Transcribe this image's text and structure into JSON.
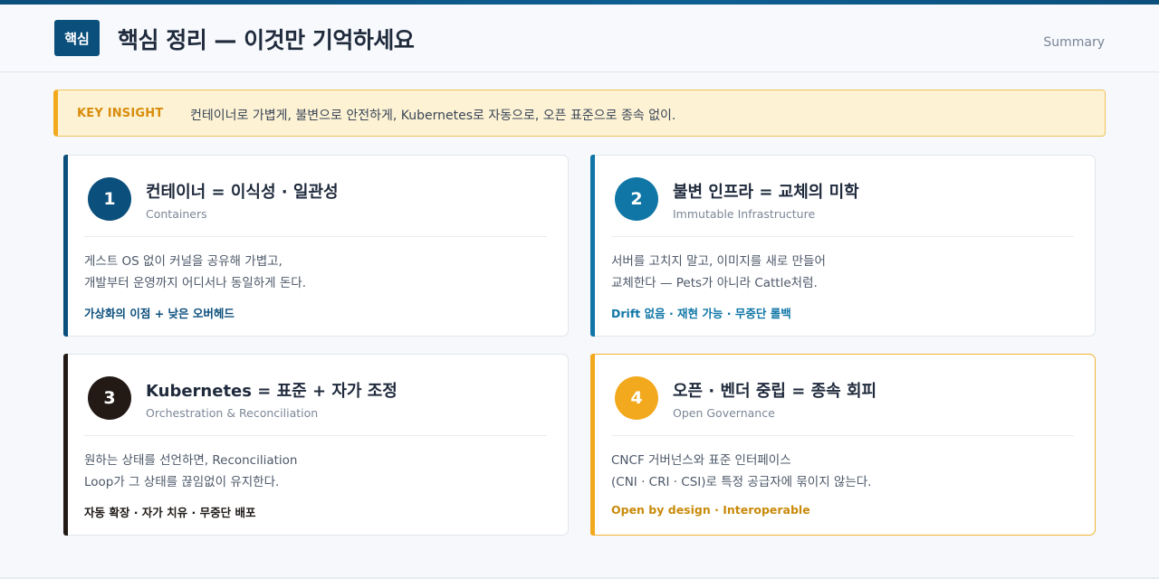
{
  "header": {
    "badge": "핵심",
    "title": "핵심 정리 — 이것만 기억하세요",
    "summary": "Summary"
  },
  "insight": {
    "label": "KEY INSIGHT",
    "text": "컨테이너로 가볍게, 불변으로 안전하게, Kubernetes로 자동으로, 오픈 표준으로 종속 없이."
  },
  "cards": [
    {
      "number": "1",
      "title": "컨테이너 = 이식성 · 일관성",
      "subtitle": "Containers",
      "body_line1": "게스트 OS 없이 커널을 공유해 가볍고,",
      "body_line2": "개발부터 운영까지 어디서나 동일하게 돈다.",
      "tag": "가상화의 이점 + 낮은 오버헤드",
      "color": "#0b4f7c",
      "tag_color": "#0b4f7c"
    },
    {
      "number": "2",
      "title": "불변 인프라 = 교체의 미학",
      "subtitle": "Immutable Infrastructure",
      "body_line1": "서버를 고치지 말고, 이미지를 새로 만들어",
      "body_line2": "교체한다 — Pets가 아니라 Cattle처럼.",
      "tag": "Drift 없음 · 재현 가능 · 무중단 롤백",
      "color": "#0f76a6",
      "tag_color": "#0f76a6"
    },
    {
      "number": "3",
      "title": "Kubernetes = 표준 + 자가 조정",
      "subtitle": "Orchestration & Reconciliation",
      "body_line1": "원하는 상태를 선언하면, Reconciliation",
      "body_line2": "Loop가 그 상태를 끊임없이 유지한다.",
      "tag": "자동 확장 · 자가 치유 · 무중단 배포",
      "color": "#231a16",
      "tag_color": "#1f1a17"
    },
    {
      "number": "4",
      "title": "오픈 · 벤더 중립 = 종속 회피",
      "subtitle": "Open Governance",
      "body_line1": "CNCF 거버넌스와 표준 인터페이스",
      "body_line2": "(CNI · CRI · CSI)로 특정 공급자에 묶이지 않는다.",
      "tag": "Open by design · Interoperable",
      "color": "#f2a91e",
      "tag_color": "#c98a0a"
    }
  ]
}
